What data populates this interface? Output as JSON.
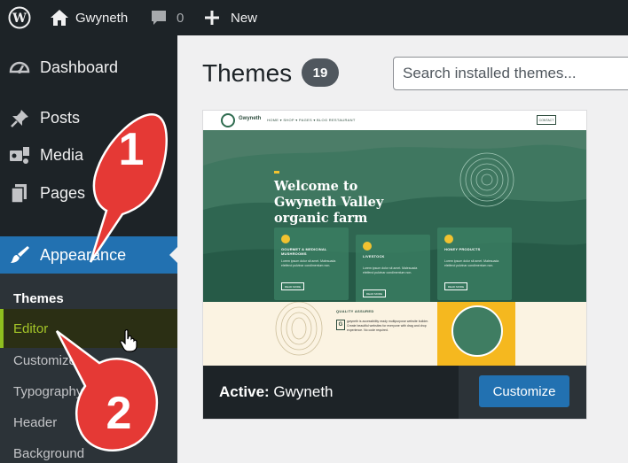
{
  "admin_bar": {
    "site_name": "Gwyneth",
    "comment_count": "0",
    "new_label": "New"
  },
  "sidebar": {
    "items": [
      {
        "label": "Dashboard",
        "icon": "dashboard-icon"
      },
      {
        "label": "Posts",
        "icon": "pin-icon"
      },
      {
        "label": "Media",
        "icon": "media-icon"
      },
      {
        "label": "Pages",
        "icon": "pages-icon"
      },
      {
        "label": "Appearance",
        "icon": "paintbrush-icon",
        "active": true
      }
    ],
    "submenu": [
      {
        "label": "Themes",
        "current": true
      },
      {
        "label": "Editor",
        "highlighted": true
      },
      {
        "label": "Customize"
      },
      {
        "label": "Typography"
      },
      {
        "label": "Header"
      },
      {
        "label": "Background"
      }
    ]
  },
  "annotations": {
    "step1": "1",
    "step2": "2",
    "color": "#e53935"
  },
  "main": {
    "title": "Themes",
    "theme_count": "19",
    "search_placeholder": "Search installed themes..."
  },
  "active_theme": {
    "active_label": "Active:",
    "name": "Gwyneth",
    "customize_label": "Customize",
    "screenshot": {
      "brand": "Gwyneth",
      "nav_links": "HOME ▾   SHOP ▾   PAGES ▾   BLOG   RESTAURANT",
      "contact": "CONTACT",
      "heading_line1": "Welcome to",
      "heading_line2": "Gwyneth Valley",
      "heading_line3": "organic farm",
      "box1_title": "GOURMET & MEDICINAL MUSHROOMS",
      "box2_title": "LIVESTOCK",
      "box3_title": "HONEY PRODUCTS",
      "box_text": "Lorem ipsum dolor sit amet. Malesuada eleifend pulvinar condimentum non.",
      "box_button": "READ MORE",
      "qa_title": "QUALITY ASSURED",
      "qa_text": "gwyneth is accessibility ready multipurpose website builder. Create beautiful websites for everyone with drag and drop experience. No code required."
    }
  },
  "colors": {
    "admin_dark": "#1d2327",
    "submenu_bg": "#2c3338",
    "accent_blue": "#2271b1",
    "editor_green": "#a3c428"
  }
}
